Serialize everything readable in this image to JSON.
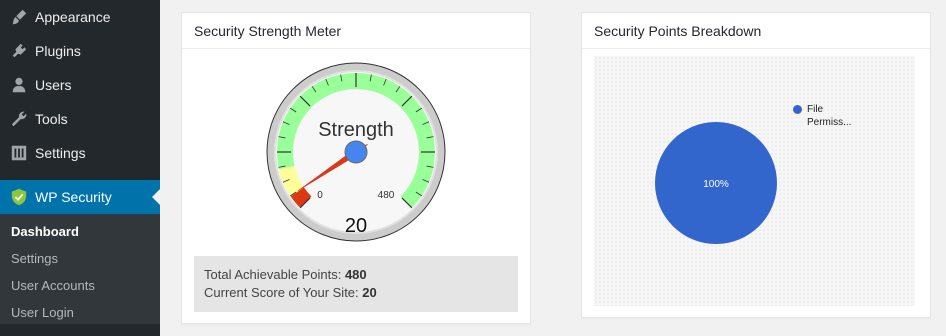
{
  "sidebar": {
    "items": [
      {
        "label": "Appearance",
        "icon": "paintbrush-icon"
      },
      {
        "label": "Plugins",
        "icon": "plugin-icon"
      },
      {
        "label": "Users",
        "icon": "users-icon"
      },
      {
        "label": "Tools",
        "icon": "wrench-icon"
      },
      {
        "label": "Settings",
        "icon": "sliders-icon"
      }
    ],
    "active": {
      "label": "WP Security",
      "icon": "shield-icon"
    },
    "submenu": [
      "Dashboard",
      "Settings",
      "User Accounts",
      "User Login"
    ]
  },
  "strength_panel": {
    "title": "Security Strength Meter",
    "gauge": {
      "label": "Strength",
      "value": "20",
      "min": "0",
      "max": "480",
      "score": 20,
      "max_value": 480
    },
    "total_label": "Total Achievable Points:",
    "total_value": "480",
    "current_label": "Current Score of Your Site:",
    "current_value": "20"
  },
  "breakdown_panel": {
    "title": "Security Points Breakdown",
    "legend": [
      "File",
      "Permiss..."
    ],
    "slice_label": "100%"
  },
  "colors": {
    "accent": "#0073aa",
    "pie": "#3366cc",
    "gauge_green": "#99ff99",
    "gauge_yellow": "#ffff99",
    "needle": "#dc3912"
  },
  "chart_data": {
    "type": "pie",
    "categories": [
      "File Permiss..."
    ],
    "values": [
      100
    ]
  }
}
